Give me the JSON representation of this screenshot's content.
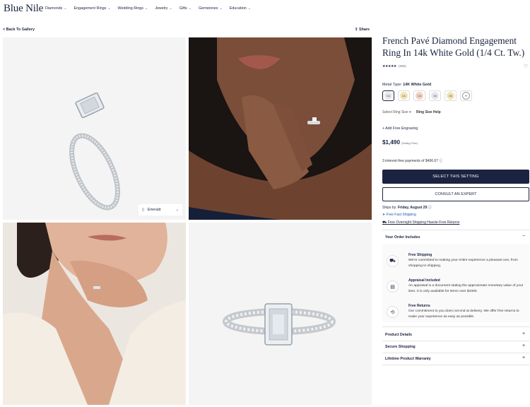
{
  "header": {
    "logo": "Blue Nile",
    "menu": [
      "Diamonds",
      "Engagement Rings",
      "Wedding Rings",
      "Jewelry",
      "Gifts",
      "Gemstones",
      "Education"
    ]
  },
  "gallery": {
    "back": "< Back To Gallery",
    "share": "Share",
    "shape_label": "Emerald"
  },
  "product": {
    "title": "French Pavé Diamond Engagement Ring In 14k White Gold (1/4 Ct. Tw.)",
    "stars": "★★★★★",
    "reviews": "(999)",
    "metal_label": "Metal Type:",
    "metal_value": "14K White Gold",
    "metals": [
      "14k",
      "14k",
      "14k",
      "18k",
      "18k",
      "Pt"
    ],
    "ring_size_label": "Select Ring Size",
    "ring_size_help": "Ring Size Help",
    "engraving": "+ Add Free Engraving",
    "price": "$1,490",
    "price_note": "(Setting Price)",
    "installments": "3 interest-free payments of $496.67 ⓘ",
    "primary_cta": "SELECT THIS SETTING",
    "secondary_cta": "CONSULT AN EXPERT",
    "ships_label": "Ships by:",
    "ships_date": "Friday, August 29",
    "fast_shipping": "Free Fast Shipping",
    "overnight": "Free Overnight Shipping Hassle-Free Returns"
  },
  "order": {
    "heading": "Your Order Includes",
    "items": [
      {
        "title": "Free Shipping",
        "text": "We're committed to making your entire experience a pleasant one, from shopping to shipping.",
        "icon": "truck-icon"
      },
      {
        "title": "Appraisal Included",
        "text": "An appraisal is a document stating the approximate monetary value of your item. It is only available for items over $1000.",
        "icon": "document-icon"
      },
      {
        "title": "Free Returns",
        "text": "Our commitment to you does not end at delivery. We offer free returns to make your experience as easy as possible.",
        "icon": "return-box-icon"
      }
    ]
  },
  "accordions": [
    "Product Details",
    "Secure Shopping",
    "Lifetime Product Warranty"
  ],
  "colors": {
    "navy": "#1c2340",
    "link_blue": "#2a5ab8"
  }
}
